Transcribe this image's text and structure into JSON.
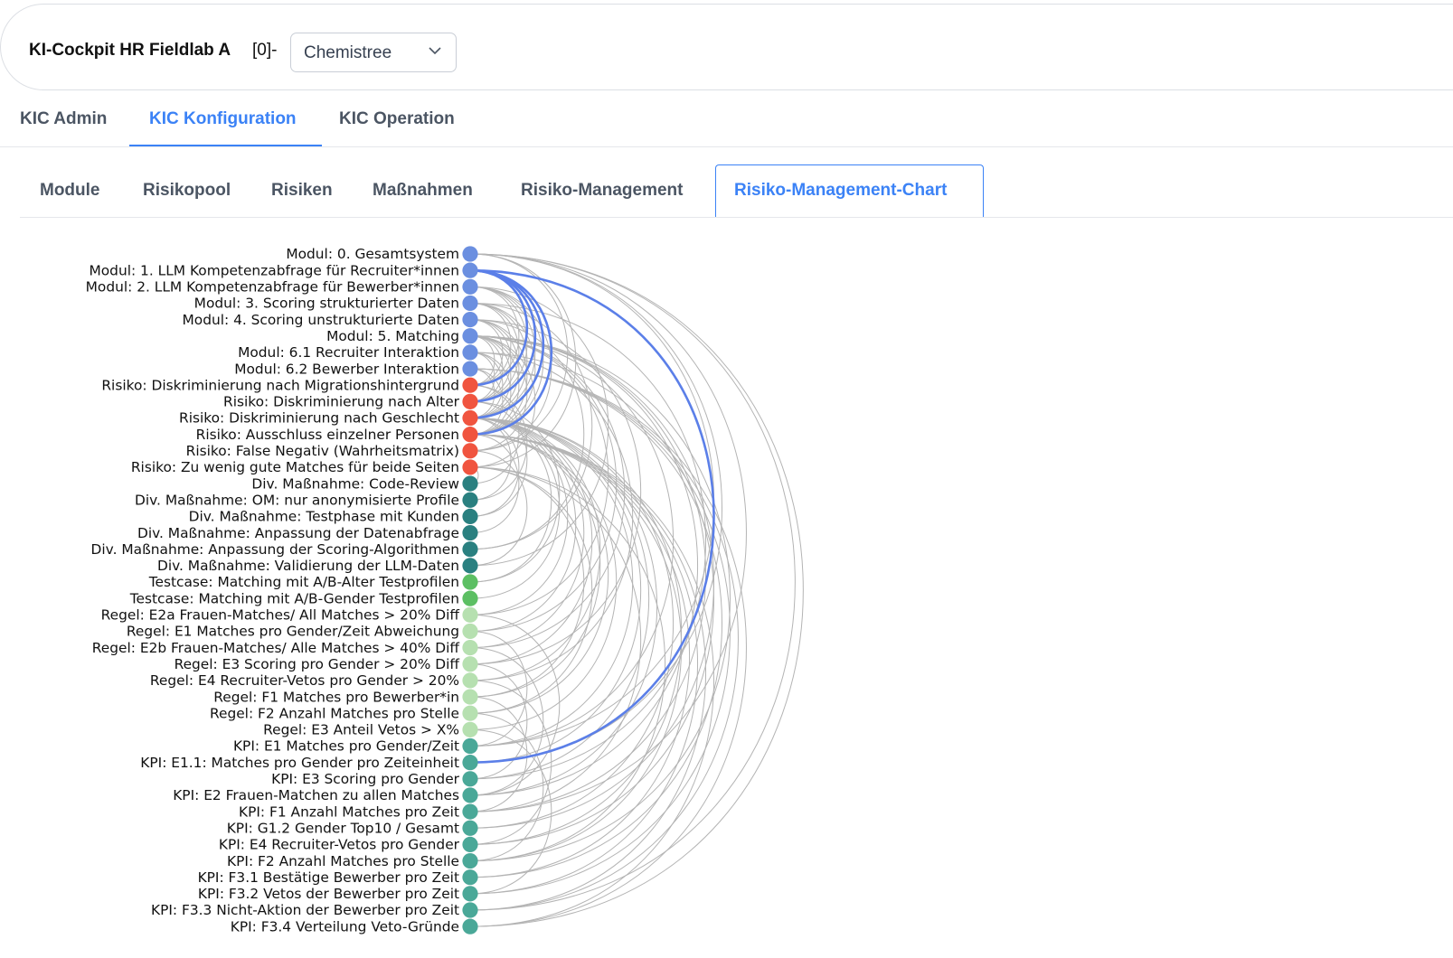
{
  "header": {
    "app_title": "KI-Cockpit HR Fieldlab A",
    "app_suffix": "[0]-",
    "select_value": "Chemistree"
  },
  "main_tabs": [
    {
      "label": "KIC Admin"
    },
    {
      "label": "KIC Konfiguration"
    },
    {
      "label": "KIC Operation"
    }
  ],
  "sub_tabs": [
    {
      "label": "Module"
    },
    {
      "label": "Risikopool"
    },
    {
      "label": "Risiken"
    },
    {
      "label": "Maßnahmen"
    },
    {
      "label": "Risiko-Management"
    },
    {
      "label": "Risiko-Management-Chart"
    }
  ],
  "chart_data": {
    "type": "arc-diagram",
    "colors": {
      "modul": "#6b8fe0",
      "risiko": "#f0543f",
      "massnahme": "#2a8080",
      "testcase": "#5cbf63",
      "regel": "#b6e0b0",
      "kpi": "#4aa898",
      "link": "#b4b4b4",
      "highlight": "#5b7fe8"
    },
    "nodes": [
      {
        "label": "Modul: 0. Gesamtsystem",
        "group": "modul"
      },
      {
        "label": "Modul: 1. LLM Kompetenzabfrage für Recruiter*innen",
        "group": "modul"
      },
      {
        "label": "Modul: 2. LLM Kompetenzabfrage für Bewerber*innen",
        "group": "modul"
      },
      {
        "label": "Modul: 3. Scoring strukturierter Daten",
        "group": "modul"
      },
      {
        "label": "Modul: 4. Scoring unstrukturierte Daten",
        "group": "modul"
      },
      {
        "label": "Modul: 5. Matching",
        "group": "modul"
      },
      {
        "label": "Modul: 6.1 Recruiter Interaktion",
        "group": "modul"
      },
      {
        "label": "Modul: 6.2 Bewerber Interaktion",
        "group": "modul"
      },
      {
        "label": "Risiko: Diskriminierung nach Migrationshintergrund",
        "group": "risiko"
      },
      {
        "label": "Risiko: Diskriminierung nach Alter",
        "group": "risiko"
      },
      {
        "label": "Risiko: Diskriminierung nach Geschlecht",
        "group": "risiko"
      },
      {
        "label": "Risiko: Ausschluss einzelner Personen",
        "group": "risiko"
      },
      {
        "label": "Risiko: False Negativ (Wahrheitsmatrix)",
        "group": "risiko"
      },
      {
        "label": "Risiko: Zu wenig gute Matches für beide Seiten",
        "group": "risiko"
      },
      {
        "label": "Div. Maßnahme: Code-Review",
        "group": "massnahme"
      },
      {
        "label": "Div. Maßnahme: OM: nur anonymisierte Profile",
        "group": "massnahme"
      },
      {
        "label": "Div. Maßnahme: Testphase mit Kunden",
        "group": "massnahme"
      },
      {
        "label": "Div. Maßnahme: Anpassung der Datenabfrage",
        "group": "massnahme"
      },
      {
        "label": "Div. Maßnahme: Anpassung der Scoring-Algorithmen",
        "group": "massnahme"
      },
      {
        "label": "Div. Maßnahme: Validierung der LLM-Daten",
        "group": "massnahme"
      },
      {
        "label": "Testcase: Matching mit A/B-Alter Testprofilen",
        "group": "testcase"
      },
      {
        "label": "Testcase: Matching mit A/B-Gender Testprofilen",
        "group": "testcase"
      },
      {
        "label": "Regel: E2a Frauen-Matches/ All Matches > 20% Diff",
        "group": "regel"
      },
      {
        "label": "Regel: E1 Matches pro Gender/Zeit Abweichung",
        "group": "regel"
      },
      {
        "label": "Regel: E2b Frauen-Matches/ Alle Matches > 40% Diff",
        "group": "regel"
      },
      {
        "label": "Regel: E3 Scoring pro Gender > 20% Diff",
        "group": "regel"
      },
      {
        "label": "Regel: E4 Recruiter-Vetos pro Gender > 20%",
        "group": "regel"
      },
      {
        "label": "Regel: F1 Matches pro Bewerber*in",
        "group": "regel"
      },
      {
        "label": "Regel: F2 Anzahl Matches pro Stelle",
        "group": "regel"
      },
      {
        "label": "Regel: E3 Anteil Vetos > X%",
        "group": "regel"
      },
      {
        "label": "KPI: E1 Matches pro Gender/Zeit",
        "group": "kpi"
      },
      {
        "label": "KPI: E1.1: Matches pro Gender pro Zeiteinheit",
        "group": "kpi"
      },
      {
        "label": "KPI: E3 Scoring pro Gender",
        "group": "kpi"
      },
      {
        "label": "KPI: E2 Frauen-Matchen zu allen Matches",
        "group": "kpi"
      },
      {
        "label": "KPI: F1 Anzahl Matches pro Zeit",
        "group": "kpi"
      },
      {
        "label": "KPI: G1.2 Gender Top10 / Gesamt",
        "group": "kpi"
      },
      {
        "label": "KPI: E4 Recruiter-Vetos pro Gender",
        "group": "kpi"
      },
      {
        "label": "KPI: F2 Anzahl Matches pro Stelle",
        "group": "kpi"
      },
      {
        "label": "KPI: F3.1 Bestätige Bewerber pro Zeit",
        "group": "kpi"
      },
      {
        "label": "KPI: F3.2 Vetos der Bewerber pro Zeit",
        "group": "kpi"
      },
      {
        "label": "KPI: F3.3 Nicht-Aktion der Bewerber pro Zeit",
        "group": "kpi"
      },
      {
        "label": "KPI: F3.4 Verteilung Veto-Gründe",
        "group": "kpi"
      }
    ],
    "links": [
      [
        0,
        30
      ],
      [
        0,
        31
      ],
      [
        0,
        34
      ],
      [
        0,
        40
      ],
      [
        0,
        41
      ],
      [
        0,
        13
      ],
      [
        0,
        12
      ],
      [
        1,
        8
      ],
      [
        1,
        9
      ],
      [
        1,
        10
      ],
      [
        1,
        11
      ],
      [
        1,
        31
      ],
      [
        2,
        8
      ],
      [
        2,
        9
      ],
      [
        2,
        10
      ],
      [
        2,
        11
      ],
      [
        2,
        12
      ],
      [
        2,
        19
      ],
      [
        3,
        8
      ],
      [
        3,
        9
      ],
      [
        3,
        10
      ],
      [
        3,
        11
      ],
      [
        3,
        18
      ],
      [
        3,
        32
      ],
      [
        4,
        8
      ],
      [
        4,
        9
      ],
      [
        4,
        10
      ],
      [
        4,
        11
      ],
      [
        4,
        18
      ],
      [
        4,
        25
      ],
      [
        5,
        8
      ],
      [
        5,
        9
      ],
      [
        5,
        10
      ],
      [
        5,
        11
      ],
      [
        5,
        12
      ],
      [
        5,
        13
      ],
      [
        5,
        22
      ],
      [
        5,
        23
      ],
      [
        5,
        24
      ],
      [
        5,
        30
      ],
      [
        5,
        33
      ],
      [
        5,
        34
      ],
      [
        5,
        35
      ],
      [
        5,
        37
      ],
      [
        6,
        9
      ],
      [
        6,
        10
      ],
      [
        6,
        11
      ],
      [
        6,
        26
      ],
      [
        6,
        36
      ],
      [
        7,
        10
      ],
      [
        7,
        11
      ],
      [
        7,
        38
      ],
      [
        7,
        39
      ],
      [
        7,
        40
      ],
      [
        7,
        41
      ],
      [
        8,
        14
      ],
      [
        8,
        15
      ],
      [
        9,
        16
      ],
      [
        9,
        20
      ],
      [
        10,
        15
      ],
      [
        10,
        16
      ],
      [
        10,
        20
      ],
      [
        10,
        21
      ],
      [
        10,
        22
      ],
      [
        10,
        23
      ],
      [
        10,
        24
      ],
      [
        10,
        25
      ],
      [
        10,
        26
      ],
      [
        10,
        30
      ],
      [
        10,
        31
      ],
      [
        10,
        32
      ],
      [
        10,
        33
      ],
      [
        10,
        35
      ],
      [
        10,
        36
      ],
      [
        11,
        17
      ],
      [
        11,
        27
      ],
      [
        11,
        28
      ],
      [
        11,
        29
      ],
      [
        11,
        37
      ],
      [
        11,
        38
      ],
      [
        11,
        39
      ],
      [
        11,
        40
      ],
      [
        11,
        41
      ],
      [
        12,
        19
      ],
      [
        13,
        14
      ],
      [
        13,
        27
      ],
      [
        13,
        28
      ],
      [
        13,
        34
      ],
      [
        13,
        37
      ],
      [
        22,
        33
      ],
      [
        23,
        30
      ],
      [
        24,
        33
      ],
      [
        25,
        32
      ],
      [
        26,
        36
      ],
      [
        27,
        34
      ],
      [
        28,
        37
      ],
      [
        29,
        39
      ]
    ],
    "highlight_links": [
      [
        1,
        8
      ],
      [
        1,
        9
      ],
      [
        1,
        10
      ],
      [
        1,
        11
      ],
      [
        1,
        31
      ]
    ]
  }
}
